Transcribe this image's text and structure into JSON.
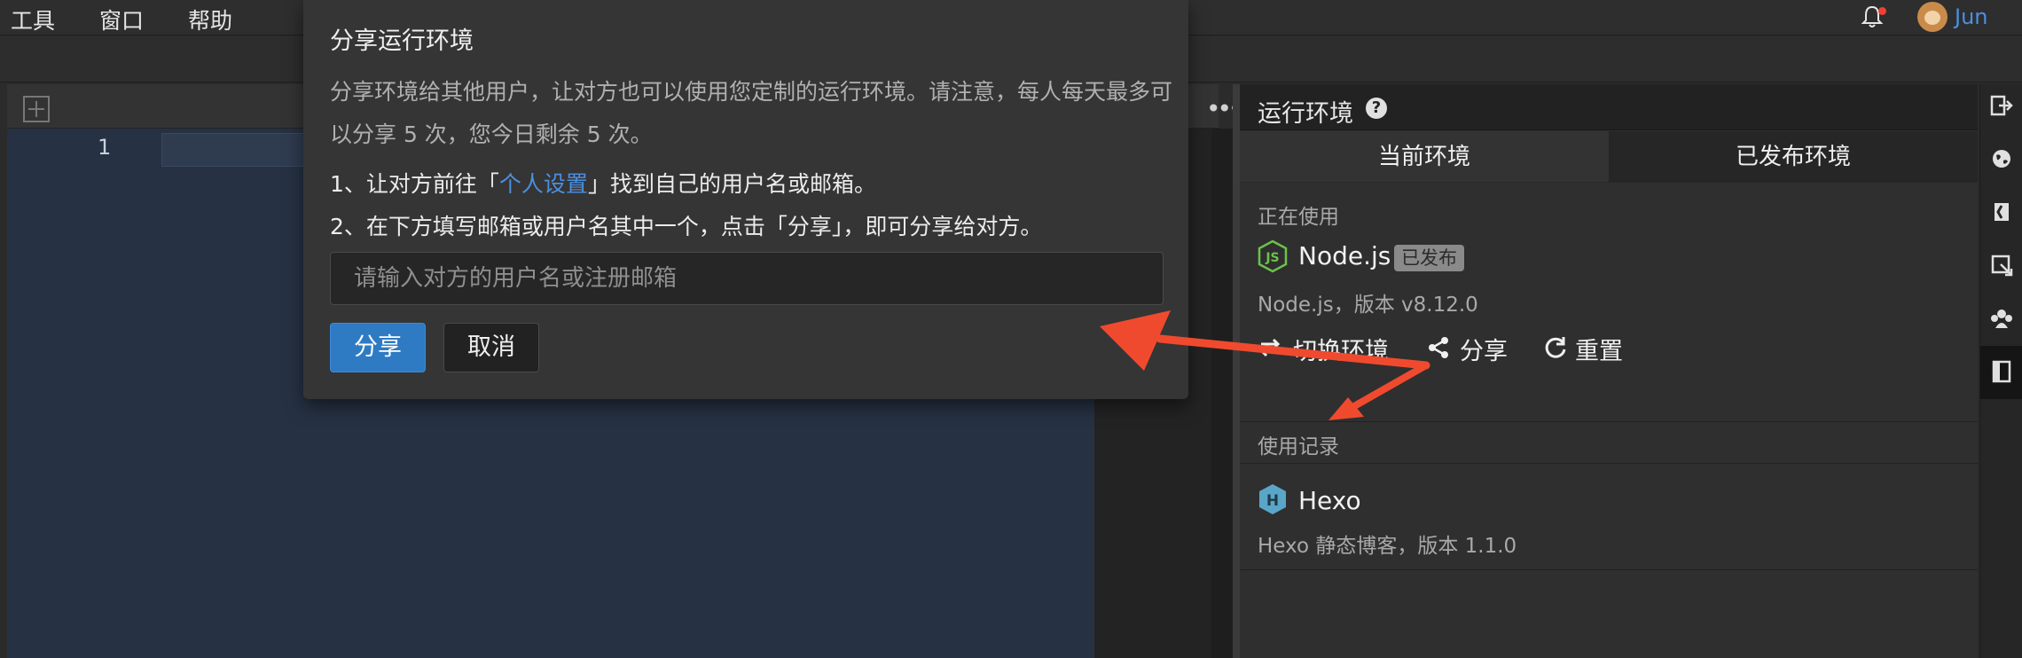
{
  "menubar": {
    "items": [
      "工具",
      "窗口",
      "帮助"
    ],
    "username": "Jun"
  },
  "editor": {
    "line_number": "1"
  },
  "panel": {
    "title": "运行环境",
    "help_glyph": "?",
    "tabs": [
      "当前环境",
      "已发布环境"
    ],
    "in_use_label": "正在使用",
    "current_env": {
      "name": "Node.js",
      "badge": "已发布",
      "description": "Node.js，版本 v8.12.0"
    },
    "actions": [
      "切换环境",
      "分享",
      "重置"
    ],
    "history_label": "使用记录",
    "history": [
      {
        "name": "Hexo",
        "description": "Hexo 静态博客，版本 1.1.0"
      }
    ]
  },
  "modal": {
    "title": "分享运行环境",
    "description": "分享环境给其他用户，让对方也可以使用您定制的运行环境。请注意，每人每天最多可以分享 5 次，您今日剩余 5 次。",
    "step1_prefix": "1、让对方前往「",
    "step1_link": "个人设置",
    "step1_suffix": "」找到自己的用户名或邮箱。",
    "step2": "2、在下方填写邮箱或用户名其中一个，点击「分享」，即可分享给对方。",
    "input_placeholder": "请输入对方的用户名或注册邮箱",
    "share_button": "分享",
    "cancel_button": "取消"
  },
  "colors": {
    "accent": "#2e7bc4",
    "link": "#4a90e2",
    "annotation_arrow": "#f04a2e"
  }
}
